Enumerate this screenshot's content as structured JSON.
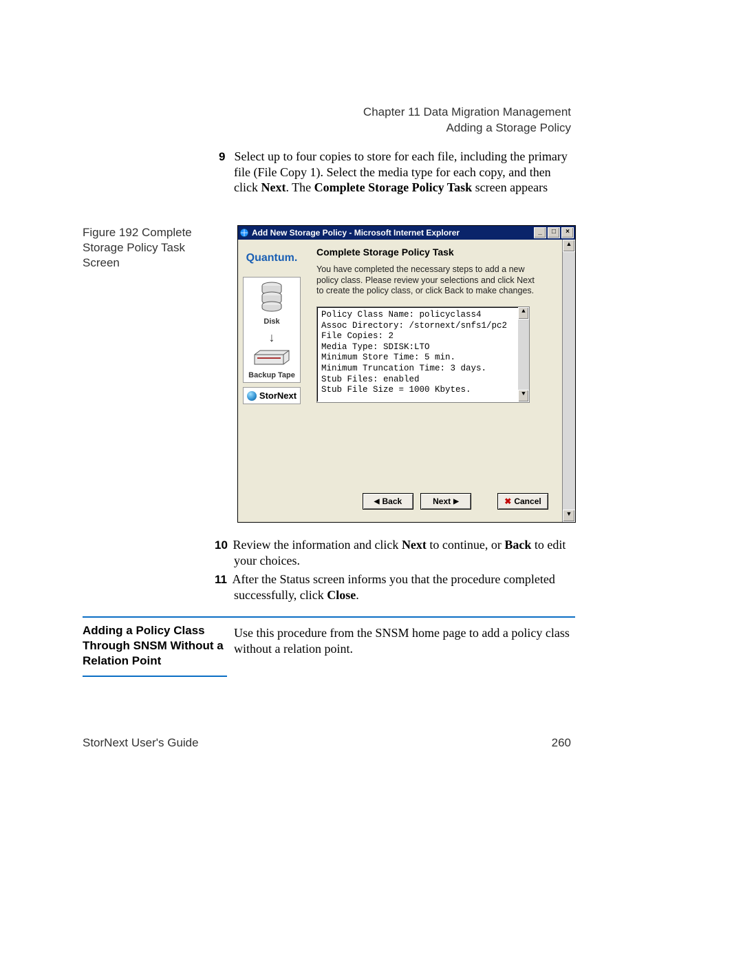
{
  "header": {
    "chapter_line": "Chapter 11  Data Migration Management",
    "section_line": "Adding a Storage Policy"
  },
  "step9": {
    "number": "9",
    "text_pre": "Select up to four copies to store for each file, including the primary file (File Copy 1). Select the media type for each copy, and then click ",
    "bold1": "Next",
    "text_mid": ". The ",
    "bold2": "Complete Storage Policy Task",
    "text_post": " screen appears"
  },
  "figure_caption": "Figure 192  Complete Storage Policy Task Screen",
  "screenshot": {
    "window_title": "Add New Storage Policy - Microsoft Internet Explorer",
    "brand": "Quantum.",
    "left_labels": {
      "disk": "Disk",
      "tape": "Backup Tape",
      "stornext": "StorNext"
    },
    "task_title": "Complete Storage Policy Task",
    "task_desc": "You have completed the necessary steps to add a new policy class. Please review your selections and click Next to create the policy class, or click Back to make changes.",
    "summary_lines": [
      "Policy Class Name: policyclass4",
      "Assoc Directory: /stornext/snfs1/pc2",
      "File Copies: 2",
      "Media Type: SDISK:LTO",
      "Minimum Store Time: 5 min.",
      "Minimum Truncation Time: 3 days.",
      "Stub Files: enabled",
      "Stub File Size = 1000 Kbytes."
    ],
    "buttons": {
      "back": "Back",
      "next": "Next",
      "cancel": "Cancel"
    }
  },
  "step10": {
    "number": "10",
    "pre": "Review the information and click ",
    "b1": "Next",
    "mid": " to continue, or ",
    "b2": "Back",
    "post": " to edit your choices."
  },
  "step11": {
    "number": "11",
    "pre": "After the Status screen informs you that the procedure completed successfully, click ",
    "b1": "Close",
    "post": "."
  },
  "subsection_heading": "Adding a Policy Class Through SNSM Without a Relation Point",
  "subsection_body": "Use this procedure from the SNSM home page to add a policy class without a relation point.",
  "footer": {
    "guide": "StorNext User's Guide",
    "page": "260"
  }
}
